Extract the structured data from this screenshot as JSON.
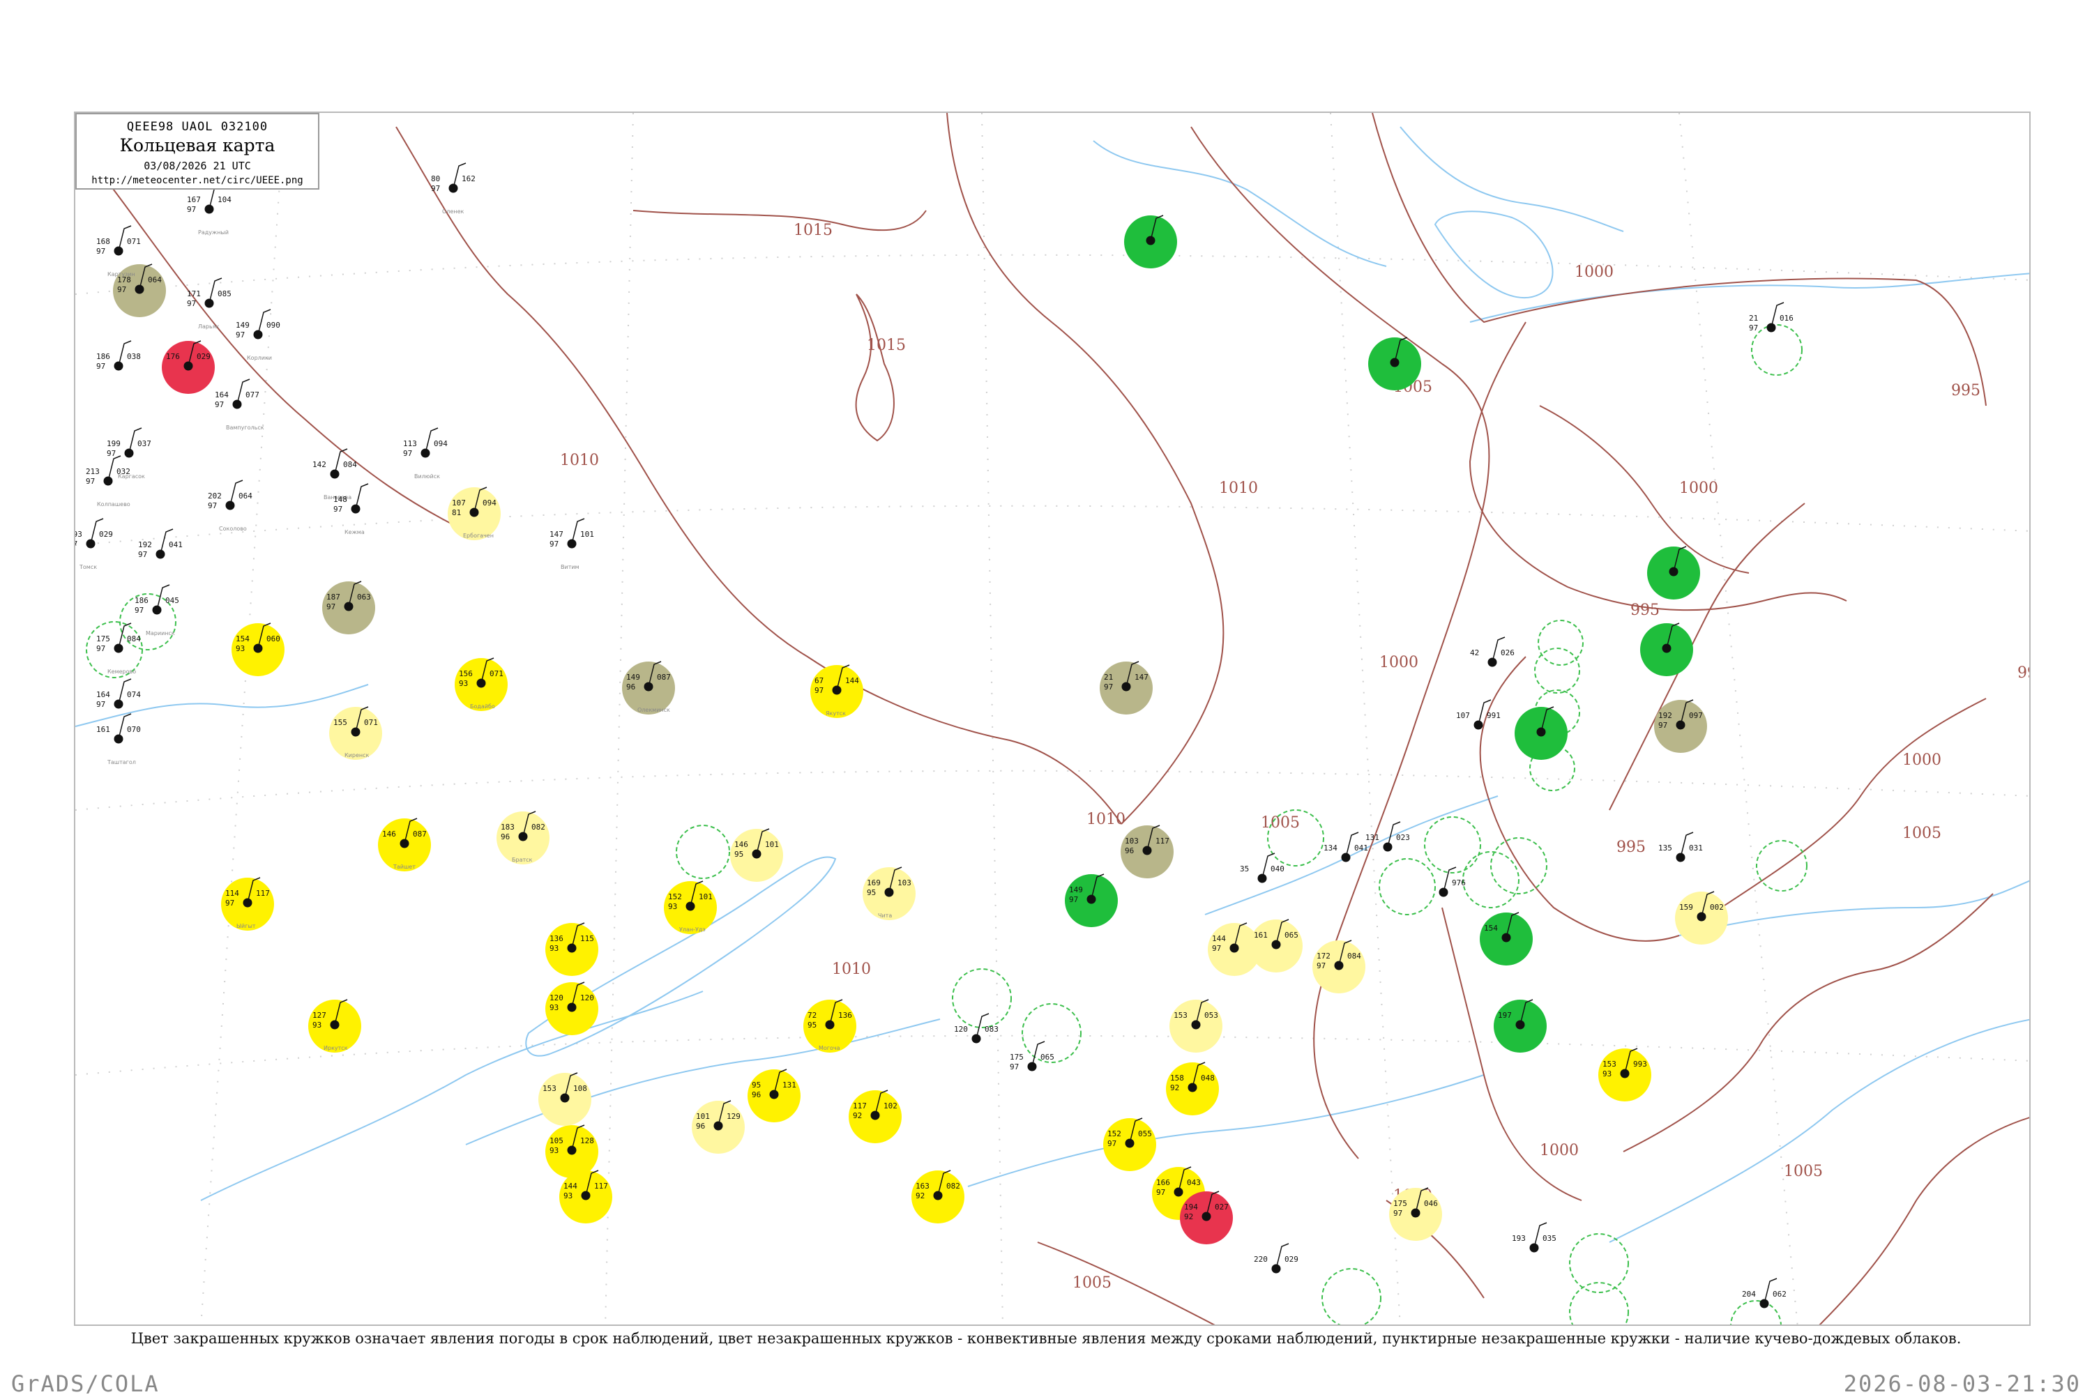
{
  "legend": {
    "code": "QEEE98  UAOL  032100",
    "title": "Кольцевая карта",
    "date": "03/08/2026 21 UTC",
    "url": "http://meteocenter.net/circ/UEEE.png"
  },
  "caption": "Цвет закрашенных кружков означает явления погоды в срок наблюдений, цвет незакрашенных кружков - конвективные явления между сроками наблюдений, пунктирные незакрашенные кружки - наличие кучево-дождевых облаков.",
  "footer": {
    "left": "GrADS/COLA",
    "right": "2026-08-03-21:30"
  },
  "colors": {
    "isobar": "#a0524a",
    "river": "#8ec8f0",
    "green": "#1fbe3c",
    "yellow": "#fff200",
    "pale_yellow": "#fff7a0",
    "olive": "#b8b68a",
    "red": "#e8344e",
    "cb_dashed": "#3cbf4c"
  },
  "isobar_labels": [
    {
      "id": "iso-1015-a",
      "text": "1015"
    },
    {
      "id": "iso-1015-b",
      "text": "1015"
    },
    {
      "id": "iso-1010-a",
      "text": "1010"
    },
    {
      "id": "iso-1010-b",
      "text": "1010"
    },
    {
      "id": "iso-1010-c",
      "text": "1010"
    },
    {
      "id": "iso-1010-d",
      "text": "1010"
    },
    {
      "id": "iso-1005-a",
      "text": "1005"
    },
    {
      "id": "iso-1005-b",
      "text": "1005"
    },
    {
      "id": "iso-1005-c",
      "text": "1005"
    },
    {
      "id": "iso-1005-d",
      "text": "1005"
    },
    {
      "id": "iso-1005-e",
      "text": "1005"
    },
    {
      "id": "iso-1000-a",
      "text": "1000"
    },
    {
      "id": "iso-1000-b",
      "text": "1000"
    },
    {
      "id": "iso-1000-c",
      "text": "1000"
    },
    {
      "id": "iso-1000-d",
      "text": "1000"
    },
    {
      "id": "iso-1000-e",
      "text": "1000"
    },
    {
      "id": "iso-1000-f",
      "text": "1000"
    },
    {
      "id": "iso-995-a",
      "text": "995"
    },
    {
      "id": "iso-995-b",
      "text": "995"
    },
    {
      "id": "iso-995-c",
      "text": "995"
    },
    {
      "id": "iso-99-d",
      "text": "99"
    }
  ],
  "stations": [
    {
      "id": "22.1",
      "kind": "red",
      "t": "176",
      "d": "",
      "p": "029",
      "name": ""
    },
    {
      "id": "22.2",
      "kind": "olive",
      "t": "178",
      "d": "97",
      "p": "064",
      "name": ""
    },
    {
      "id": "22.3",
      "kind": "none",
      "t": "168",
      "d": "97",
      "p": "071",
      "name": "Картузин"
    },
    {
      "id": "22.4",
      "kind": "none",
      "t": "167",
      "d": "97",
      "p": "104",
      "name": "Радужный"
    },
    {
      "id": "22.5",
      "kind": "none",
      "t": "171",
      "d": "97",
      "p": "085",
      "name": "Ларьяк"
    },
    {
      "id": "22.6",
      "kind": "none",
      "t": "149",
      "d": "97",
      "p": "090",
      "name": "Корлики"
    },
    {
      "id": "22.7",
      "kind": "none",
      "t": "186",
      "d": "97",
      "p": "038",
      "name": ""
    },
    {
      "id": "22.8",
      "kind": "none",
      "t": "164",
      "d": "97",
      "p": "077",
      "name": "Вампугольск"
    },
    {
      "id": "22.9",
      "kind": "none",
      "t": "199",
      "d": "97",
      "p": "037",
      "name": "Каргасок"
    },
    {
      "id": "22.10",
      "kind": "none",
      "t": "213",
      "d": "97",
      "p": "032",
      "name": "Колпашево"
    },
    {
      "id": "22.11",
      "kind": "none",
      "t": "202",
      "d": "97",
      "p": "064",
      "name": "Соколово"
    },
    {
      "id": "22.12",
      "kind": "none",
      "t": "193",
      "d": "97",
      "p": "029",
      "name": "Томск"
    },
    {
      "id": "22.13",
      "kind": "none",
      "t": "192",
      "d": "97",
      "p": "041",
      "name": ""
    },
    {
      "id": "22.14",
      "kind": "none",
      "t": "186",
      "d": "97",
      "p": "045",
      "name": "Мариинск"
    },
    {
      "id": "22.15",
      "kind": "none",
      "t": "175",
      "d": "97",
      "p": "084",
      "name": "Кемерово"
    },
    {
      "id": "22.16",
      "kind": "none",
      "t": "164",
      "d": "97",
      "p": "074",
      "name": ""
    },
    {
      "id": "22.17",
      "kind": "none",
      "t": "161",
      "d": "",
      "p": "070",
      "name": "Таштагол"
    },
    {
      "id": "22.18",
      "kind": "yellow",
      "t": "154",
      "d": "93",
      "p": "060",
      "name": ""
    },
    {
      "id": "22.19",
      "kind": "olive",
      "t": "187",
      "d": "97",
      "p": "063",
      "name": ""
    },
    {
      "id": "22.20",
      "kind": "none",
      "t": "142",
      "d": "",
      "p": "084",
      "name": "Ванавара"
    },
    {
      "id": "22.21",
      "kind": "none",
      "t": "148",
      "d": "97",
      "p": "",
      "name": "Кежма"
    },
    {
      "id": "22.22",
      "kind": "paleyellow",
      "t": "107",
      "d": "81",
      "p": "094",
      "name": "Ербогачен"
    },
    {
      "id": "22.23",
      "kind": "none",
      "t": "113",
      "d": "97",
      "p": "094",
      "name": "Вилюйск"
    },
    {
      "id": "22.24",
      "kind": "none",
      "t": "80",
      "d": "97",
      "p": "162",
      "name": "Оленек"
    },
    {
      "id": "22.25",
      "kind": "none",
      "t": "147",
      "d": "97",
      "p": "101",
      "name": "Витим"
    },
    {
      "id": "22.26",
      "kind": "olive",
      "t": "149",
      "d": "96",
      "p": "087",
      "name": "Олекминск"
    },
    {
      "id": "22.27",
      "kind": "yellow",
      "t": "67",
      "d": "97",
      "p": "144",
      "name": "Якутск"
    },
    {
      "id": "22.28",
      "kind": "yellow",
      "t": "156",
      "d": "93",
      "p": "071",
      "name": "Бодайбо"
    },
    {
      "id": "22.29",
      "kind": "paleyellow",
      "t": "155",
      "d": "",
      "p": "071",
      "name": "Киренск"
    },
    {
      "id": "22.30",
      "kind": "yellow",
      "t": "146",
      "d": "",
      "p": "087",
      "name": "Тайшет"
    },
    {
      "id": "22.31",
      "kind": "paleyellow",
      "t": "183",
      "d": "96",
      "p": "082",
      "name": "Братск"
    },
    {
      "id": "22.32",
      "kind": "yellow",
      "t": "114",
      "d": "97",
      "p": "117",
      "name": "Ыйгыт"
    },
    {
      "id": "22.33",
      "kind": "yellow",
      "t": "127",
      "d": "93",
      "p": "",
      "name": "Иркутск"
    },
    {
      "id": "22.34",
      "kind": "yellow",
      "t": "136",
      "d": "93",
      "p": "115",
      "name": ""
    },
    {
      "id": "22.35",
      "kind": "yellow",
      "t": "120",
      "d": "93",
      "p": "120",
      "name": ""
    },
    {
      "id": "22.36",
      "kind": "yellow",
      "t": "152",
      "d": "93",
      "p": "101",
      "name": "Улан-Удэ"
    },
    {
      "id": "22.37",
      "kind": "paleyellow",
      "t": "146",
      "d": "95",
      "p": "101",
      "name": ""
    },
    {
      "id": "22.38",
      "kind": "paleyellow",
      "t": "169",
      "d": "95",
      "p": "103",
      "name": "Чита"
    },
    {
      "id": "22.39",
      "kind": "yellow",
      "t": "72",
      "d": "95",
      "p": "136",
      "name": "Могоча"
    },
    {
      "id": "22.40",
      "kind": "yellow",
      "t": "95",
      "d": "96",
      "p": "131",
      "name": ""
    },
    {
      "id": "22.41",
      "kind": "yellow",
      "t": "117",
      "d": "92",
      "p": "102",
      "name": ""
    },
    {
      "id": "22.42",
      "kind": "paleyellow",
      "t": "101",
      "d": "96",
      "p": "129",
      "name": ""
    },
    {
      "id": "22.43",
      "kind": "yellow",
      "t": "163",
      "d": "92",
      "p": "082",
      "name": ""
    },
    {
      "id": "22.44",
      "kind": "yellow",
      "t": "105",
      "d": "93",
      "p": "128",
      "name": ""
    },
    {
      "id": "22.45",
      "kind": "paleyellow",
      "t": "153",
      "d": "",
      "p": "108",
      "name": ""
    },
    {
      "id": "22.46",
      "kind": "yellow",
      "t": "144",
      "d": "93",
      "p": "117",
      "name": ""
    },
    {
      "id": "22.47",
      "kind": "yellow",
      "t": "152",
      "d": "97",
      "p": "055",
      "name": ""
    },
    {
      "id": "22.48",
      "kind": "yellow",
      "t": "166",
      "d": "97",
      "p": "043",
      "name": ""
    },
    {
      "id": "22.49",
      "kind": "red",
      "t": "194",
      "d": "92",
      "p": "027",
      "name": ""
    },
    {
      "id": "22.50",
      "kind": "yellow",
      "t": "158",
      "d": "92",
      "p": "048",
      "name": ""
    },
    {
      "id": "22.51",
      "kind": "paleyellow",
      "t": "153",
      "d": "",
      "p": "053",
      "name": ""
    },
    {
      "id": "22.52",
      "kind": "paleyellow",
      "t": "144",
      "d": "97",
      "p": "",
      "name": ""
    },
    {
      "id": "22.53",
      "kind": "paleyellow",
      "t": "161",
      "d": "",
      "p": "065",
      "name": ""
    },
    {
      "id": "22.54",
      "kind": "paleyellow",
      "t": "172",
      "d": "97",
      "p": "084",
      "name": ""
    },
    {
      "id": "22.55",
      "kind": "green",
      "t": "149",
      "d": "97",
      "p": "",
      "name": ""
    },
    {
      "id": "22.56",
      "kind": "olive",
      "t": "103",
      "d": "96",
      "p": "117",
      "name": ""
    },
    {
      "id": "22.57",
      "kind": "olive",
      "t": "21",
      "d": "97",
      "p": "147",
      "name": ""
    },
    {
      "id": "22.58",
      "kind": "green",
      "t": "",
      "d": "",
      "p": "",
      "name": ""
    },
    {
      "id": "22.59",
      "kind": "green",
      "t": "",
      "d": "",
      "p": "",
      "name": ""
    },
    {
      "id": "22.60",
      "kind": "green",
      "t": "",
      "d": "",
      "p": "",
      "name": ""
    },
    {
      "id": "22.61",
      "kind": "green",
      "t": "",
      "d": "",
      "p": "",
      "name": ""
    },
    {
      "id": "22.62",
      "kind": "green",
      "t": "",
      "d": "",
      "p": "",
      "name": ""
    },
    {
      "id": "22.63",
      "kind": "green",
      "t": "154",
      "d": "",
      "p": "",
      "name": ""
    },
    {
      "id": "22.64",
      "kind": "green",
      "t": "197",
      "d": "",
      "p": "",
      "name": ""
    },
    {
      "id": "22.65",
      "kind": "olive",
      "t": "192",
      "d": "97",
      "p": "097",
      "name": ""
    },
    {
      "id": "22.66",
      "kind": "yellow",
      "t": "153",
      "d": "93",
      "p": "993",
      "name": ""
    },
    {
      "id": "22.67",
      "kind": "paleyellow",
      "t": "159",
      "d": "",
      "p": "002",
      "name": ""
    },
    {
      "id": "22.68",
      "kind": "paleyellow",
      "t": "175",
      "d": "97",
      "p": "046",
      "name": ""
    },
    {
      "id": "22.69",
      "kind": "none",
      "t": "220",
      "d": "",
      "p": "029",
      "name": ""
    },
    {
      "id": "22.70",
      "kind": "none",
      "t": "175",
      "d": "97",
      "p": "065",
      "name": ""
    },
    {
      "id": "22.71",
      "kind": "none",
      "t": "120",
      "d": "",
      "p": "083",
      "name": ""
    },
    {
      "id": "22.72",
      "kind": "none",
      "t": "35",
      "d": "",
      "p": "040",
      "name": ""
    },
    {
      "id": "22.73",
      "kind": "none",
      "t": "134",
      "d": "",
      "p": "041",
      "name": ""
    },
    {
      "id": "22.74",
      "kind": "none",
      "t": "131",
      "d": "",
      "p": "023",
      "name": ""
    },
    {
      "id": "22.75",
      "kind": "none",
      "t": "",
      "d": "",
      "p": "976",
      "name": ""
    },
    {
      "id": "22.76",
      "kind": "none",
      "t": "21",
      "d": "97",
      "p": "016",
      "name": ""
    },
    {
      "id": "22.77",
      "kind": "none",
      "t": "42",
      "d": "",
      "p": "026",
      "name": ""
    },
    {
      "id": "22.78",
      "kind": "none",
      "t": "107",
      "d": "",
      "p": "991",
      "name": ""
    },
    {
      "id": "22.79",
      "kind": "none",
      "t": "135",
      "d": "",
      "p": "031",
      "name": ""
    },
    {
      "id": "22.80",
      "kind": "none",
      "t": "204",
      "d": "",
      "p": "062",
      "name": ""
    },
    {
      "id": "22.81",
      "kind": "none",
      "t": "193",
      "d": "",
      "p": "035",
      "name": ""
    }
  ]
}
